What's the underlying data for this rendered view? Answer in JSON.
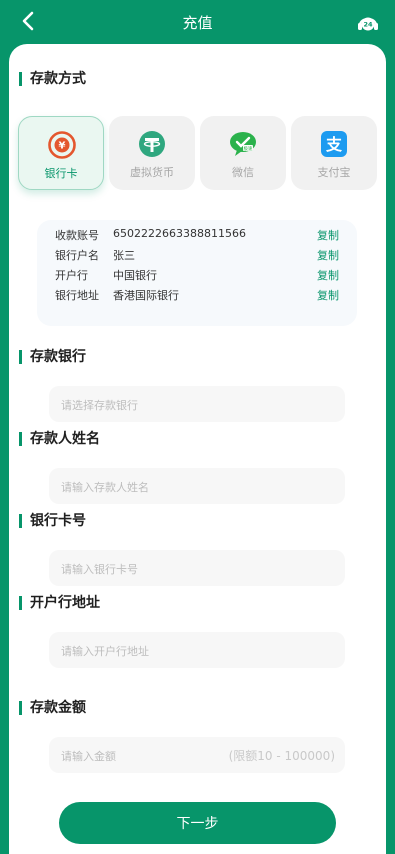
{
  "header": {
    "title": "充值"
  },
  "sections": {
    "method": "存款方式",
    "bank": "存款银行",
    "name": "存款人姓名",
    "card": "银行卡号",
    "address": "开户行地址",
    "amount": "存款金额"
  },
  "methods": [
    {
      "label": "银行卡",
      "active": true
    },
    {
      "label": "虚拟货币",
      "active": false
    },
    {
      "label": "微信",
      "active": false
    },
    {
      "label": "支付宝",
      "active": false
    }
  ],
  "info": [
    {
      "key": "收款账号",
      "value": "6502222663388811566",
      "copy": "复制"
    },
    {
      "key": "银行户名",
      "value": "张三",
      "copy": "复制"
    },
    {
      "key": "开户行",
      "value": "中国银行",
      "copy": "复制"
    },
    {
      "key": "银行地址",
      "value": "香港国际银行",
      "copy": "复制"
    }
  ],
  "fields": {
    "bank_placeholder": "请选择存款银行",
    "name_placeholder": "请输入存款人姓名",
    "card_placeholder": "请输入银行卡号",
    "address_placeholder": "请输入开户行地址",
    "amount_placeholder": "请输入金额",
    "amount_limit": "(限额10 - 100000)"
  },
  "actions": {
    "next_label": "下一步"
  },
  "icons": {
    "back": "chevron-left-icon",
    "support": "headset-24-icon",
    "bank_card": "yuan-coin-icon",
    "crypto": "tether-icon",
    "wechat": "wechat-icon",
    "alipay": "alipay-icon"
  },
  "colors": {
    "brand": "#07956a",
    "card_bg": "#ffffff",
    "placeholder": "#bdbdbd"
  }
}
